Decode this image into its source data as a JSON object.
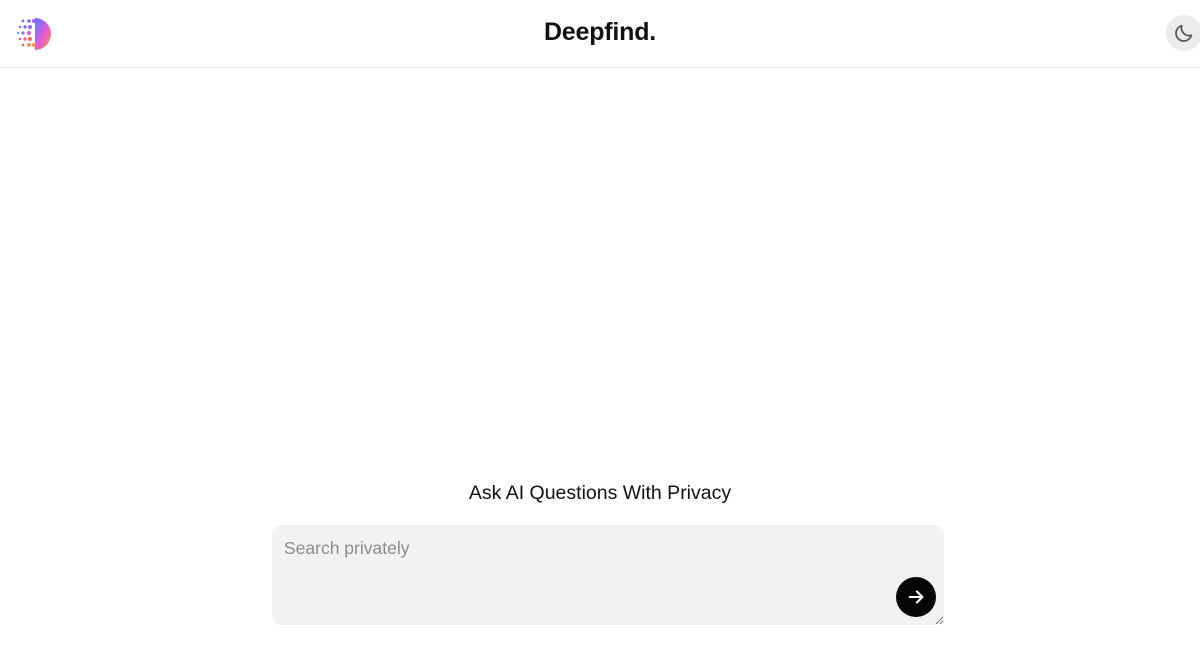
{
  "header": {
    "brand": "Deepfind.",
    "logo_icon": "gradient-dot-halfcircle-logo",
    "theme_toggle_icon": "moon-icon"
  },
  "hero": {
    "tagline": "Ask AI Questions With Privacy"
  },
  "search": {
    "value": "",
    "placeholder": "Search privately",
    "submit_icon": "arrow-right-icon"
  },
  "colors": {
    "background": "#ffffff",
    "search_background": "#f2f2f2",
    "submit_button": "#050505",
    "logo_gradient_start": "#4f7dff",
    "logo_gradient_middle": "#e85ad6",
    "logo_gradient_end": "#ff9a2e"
  }
}
